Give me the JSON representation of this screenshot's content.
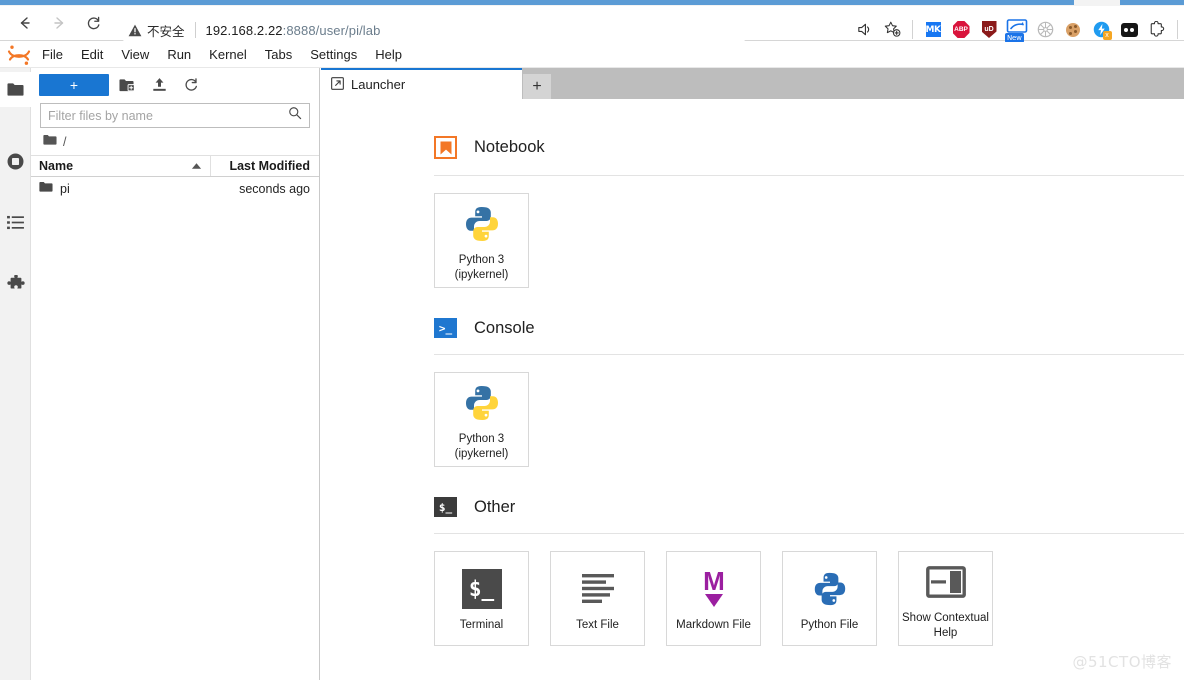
{
  "browser": {
    "nav": {
      "back_icon": "arrow-left-icon",
      "forward_icon": "arrow-right-icon",
      "reload_icon": "reload-icon"
    },
    "security": {
      "icon": "warning-triangle-icon",
      "label": "不安全"
    },
    "url": {
      "host": "192.168.2.22",
      "rest": ":8888/user/pi/lab",
      "full": "192.168.2.22:8888/user/pi/lab"
    },
    "toolbar_icons": [
      "read-aloud-icon",
      "add-favorite-icon",
      "extension-mk-icon",
      "extension-adblockplus-icon",
      "extension-ublock-icon",
      "extension-new-tab-icon",
      "extension-gray-wheel-icon",
      "extension-cookie-icon",
      "extension-flash-icon",
      "extension-blackbox-icon",
      "extension-puzzle-icon"
    ],
    "ext_labels": {
      "mk": "MK",
      "abp": "ABP",
      "ud": "uD",
      "new": "New",
      "flash_badge": "x"
    }
  },
  "jupyter": {
    "logo": "jupyter-logo-icon",
    "menu": [
      {
        "label": "File"
      },
      {
        "label": "Edit"
      },
      {
        "label": "View"
      },
      {
        "label": "Run"
      },
      {
        "label": "Kernel"
      },
      {
        "label": "Tabs"
      },
      {
        "label": "Settings"
      },
      {
        "label": "Help"
      }
    ],
    "activitybar": [
      {
        "name": "file-browser",
        "icon": "folder-icon",
        "active": true
      },
      {
        "name": "running-terminals",
        "icon": "running-circle-icon",
        "active": false
      },
      {
        "name": "command-palette",
        "icon": "list-icon",
        "active": false
      },
      {
        "name": "extension-manager",
        "icon": "puzzle-piece-icon",
        "active": false
      }
    ],
    "filebrowser": {
      "new_launcher_label": "+",
      "toolbar_icons": [
        "new-folder-icon",
        "upload-icon",
        "refresh-icon"
      ],
      "filter_placeholder": "Filter files by name",
      "filter_value": "",
      "search_icon": "search-icon",
      "breadcrumb_root": "/",
      "breadcrumb_icon": "folder-icon",
      "columns": {
        "name": "Name",
        "last_modified": "Last Modified",
        "sort_icon": "sort-ascending-icon"
      },
      "rows": [
        {
          "icon": "folder-icon",
          "name": "pi",
          "modified": "seconds ago"
        }
      ]
    },
    "tabbar": {
      "tabs": [
        {
          "label": "Launcher",
          "icon": "launcher-icon",
          "active": true
        }
      ],
      "add_tab_label": "+"
    },
    "launcher": {
      "sections": [
        {
          "id": "notebook",
          "title": "Notebook",
          "icon": "notebook-bookmark-icon",
          "cards": [
            {
              "icon": "python-logo-icon",
              "label": "Python 3\n(ipykernel)",
              "line1": "Python 3",
              "line2": "(ipykernel)"
            }
          ]
        },
        {
          "id": "console",
          "title": "Console",
          "icon": "console-prompt-icon",
          "icon_text": ">_",
          "cards": [
            {
              "icon": "python-logo-icon",
              "label": "Python 3\n(ipykernel)",
              "line1": "Python 3",
              "line2": "(ipykernel)"
            }
          ]
        },
        {
          "id": "other",
          "title": "Other",
          "icon": "terminal-dollar-icon",
          "icon_text": "$_",
          "cards": [
            {
              "icon": "terminal-icon",
              "label": "Terminal",
              "icon_text": "$_"
            },
            {
              "icon": "text-file-icon",
              "label": "Text File"
            },
            {
              "icon": "markdown-icon",
              "label": "Markdown File"
            },
            {
              "icon": "python-file-icon",
              "label": "Python File"
            },
            {
              "icon": "contextual-help-icon",
              "label": "Show Contextual\nHelp",
              "line1": "Show Contextual",
              "line2": "Help"
            }
          ]
        }
      ]
    }
  },
  "watermark": "@51CTO博客",
  "colors": {
    "jupyter_orange": "#f37726",
    "accent_blue": "#1976d2",
    "console_blue": "#1f77d0",
    "markdown_purple": "#9b1fa0",
    "python_blue": "#3572a5",
    "python_yellow": "#ffd43b",
    "tabbar_gray": "#bdbdbd"
  }
}
